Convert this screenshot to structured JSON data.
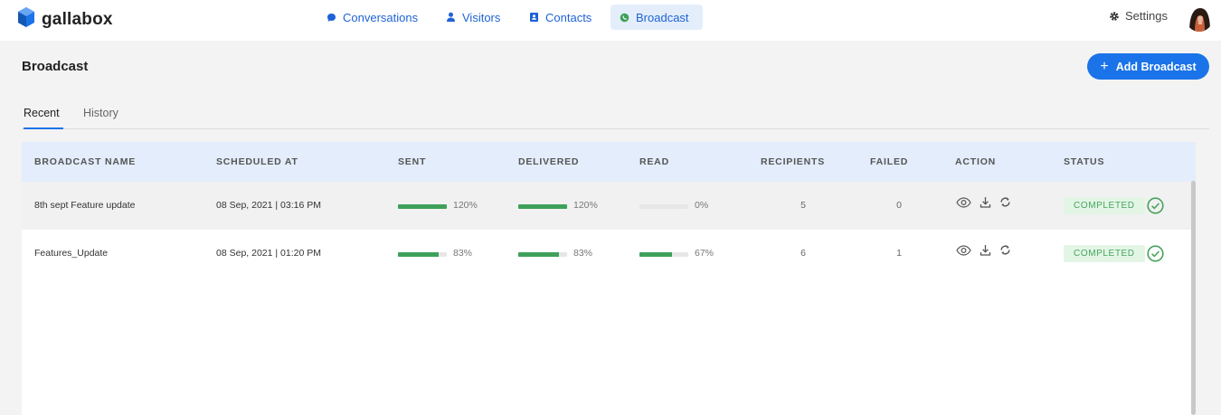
{
  "app": {
    "logo_text": "gallabox"
  },
  "nav": {
    "items": [
      {
        "label": "Conversations",
        "icon": "chat-bubble-icon",
        "active": false
      },
      {
        "label": "Visitors",
        "icon": "person-icon",
        "active": false
      },
      {
        "label": "Contacts",
        "icon": "contact-book-icon",
        "active": false
      },
      {
        "label": "Broadcast",
        "icon": "whatsapp-icon",
        "active": true
      }
    ],
    "settings_label": "Settings",
    "accent_color": "#1a73e8"
  },
  "page": {
    "title": "Broadcast",
    "add_button_label": "+ Add Broadcast",
    "add_button_text": "Add Broadcast"
  },
  "tabs": [
    {
      "label": "Recent",
      "active": true
    },
    {
      "label": "History",
      "active": false
    }
  ],
  "table": {
    "columns": [
      "BROADCAST NAME",
      "SCHEDULED AT",
      "SENT",
      "DELIVERED",
      "READ",
      "RECIPIENTS",
      "FAILED",
      "ACTION",
      "STATUS"
    ],
    "rows": [
      {
        "name": "8th sept Feature update",
        "scheduled_at": "08 Sep, 2021 | 03:16 PM",
        "sent": {
          "label": "120%",
          "fraction": 1.0
        },
        "delivered": {
          "label": "120%",
          "fraction": 1.0
        },
        "read": {
          "label": "0%",
          "fraction": 0.0
        },
        "recipients": "5",
        "failed": "0",
        "status": "COMPLETED"
      },
      {
        "name": "Features_Update",
        "scheduled_at": "08 Sep, 2021 | 01:20 PM",
        "sent": {
          "label": "83%",
          "fraction": 0.83
        },
        "delivered": {
          "label": "83%",
          "fraction": 0.83
        },
        "read": {
          "label": "67%",
          "fraction": 0.67
        },
        "recipients": "6",
        "failed": "1",
        "status": "COMPLETED"
      }
    ]
  },
  "colors": {
    "progress": "#3ea05a",
    "status_badge_bg": "#e3f6e6",
    "status_badge_text": "#45a45c",
    "header_bg": "#e3edfb"
  }
}
